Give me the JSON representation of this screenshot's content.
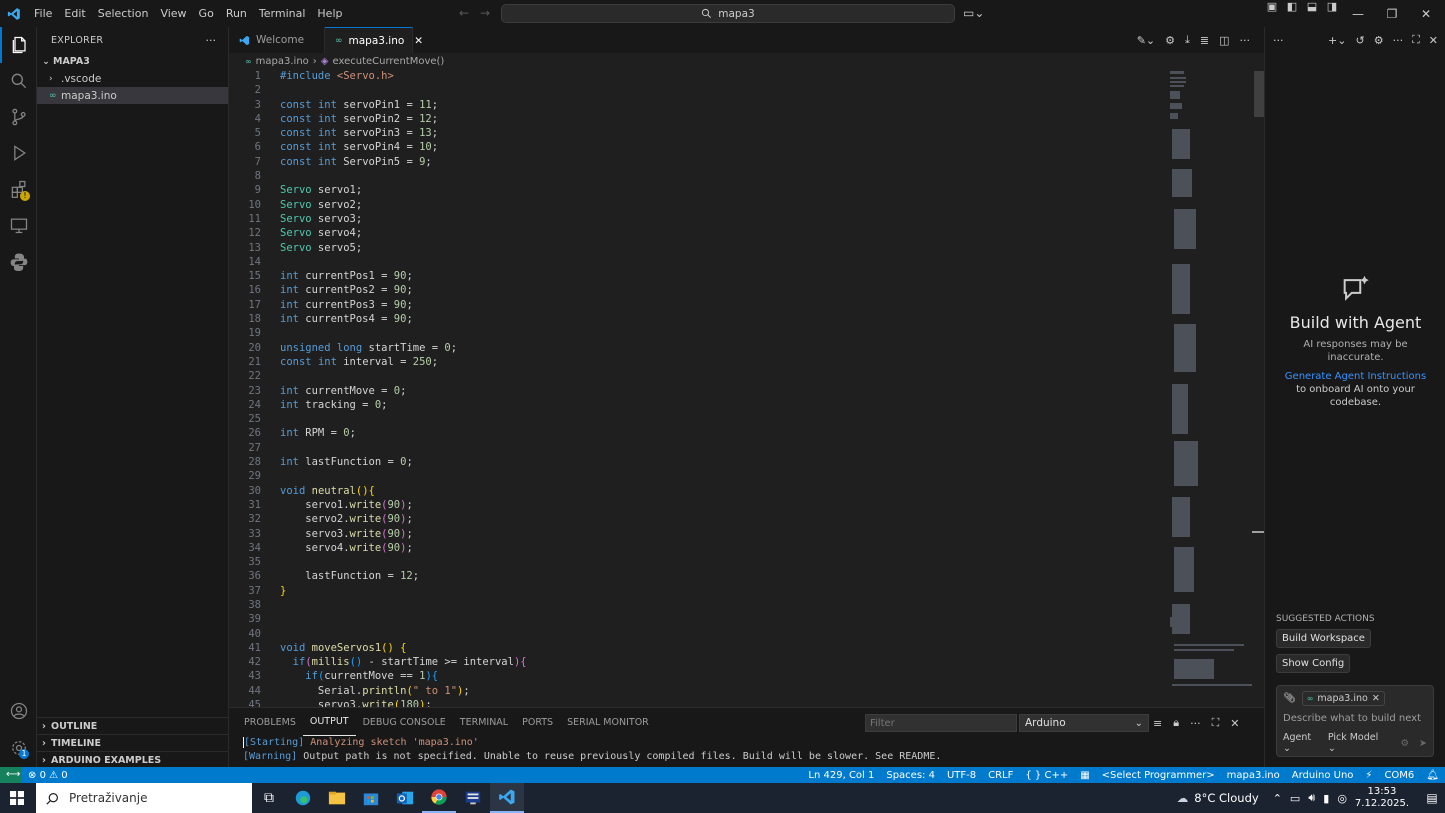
{
  "menu": [
    "File",
    "Edit",
    "Selection",
    "View",
    "Go",
    "Run",
    "Terminal",
    "Help"
  ],
  "search": {
    "text": "mapa3"
  },
  "sidebar": {
    "title": "EXPLORER",
    "root": "MAPA3",
    "items": [
      ".vscode",
      "mapa3.ino"
    ],
    "sections": [
      "OUTLINE",
      "TIMELINE",
      "ARDUINO EXAMPLES"
    ]
  },
  "tabs": [
    "Welcome",
    "mapa3.ino"
  ],
  "breadcrumb": {
    "file": "mapa3.ino",
    "symbol": "executeCurrentMove()"
  },
  "code": [
    {
      "n": "1",
      "h": "<span class='k'>#include</span> <span class='s'>&lt;Servo.h&gt;</span>"
    },
    {
      "n": "2",
      "h": ""
    },
    {
      "n": "3",
      "h": "<span class='k'>const</span> <span class='k'>int</span> servoPin1 = <span class='n'>11</span>;"
    },
    {
      "n": "4",
      "h": "<span class='k'>const</span> <span class='k'>int</span> servoPin2 = <span class='n'>12</span>;"
    },
    {
      "n": "5",
      "h": "<span class='k'>const</span> <span class='k'>int</span> servoPin3 = <span class='n'>13</span>;"
    },
    {
      "n": "6",
      "h": "<span class='k'>const</span> <span class='k'>int</span> servoPin4 = <span class='n'>10</span>;"
    },
    {
      "n": "7",
      "h": "<span class='k'>const</span> <span class='k'>int</span> ServoPin5 = <span class='n'>9</span>;"
    },
    {
      "n": "8",
      "h": ""
    },
    {
      "n": "9",
      "h": "<span class='t'>Servo</span> servo1;"
    },
    {
      "n": "10",
      "h": "<span class='t'>Servo</span> servo2;"
    },
    {
      "n": "11",
      "h": "<span class='t'>Servo</span> servo3;"
    },
    {
      "n": "12",
      "h": "<span class='t'>Servo</span> servo4;"
    },
    {
      "n": "13",
      "h": "<span class='t'>Servo</span> servo5;"
    },
    {
      "n": "14",
      "h": ""
    },
    {
      "n": "15",
      "h": "<span class='k'>int</span> currentPos1 = <span class='n'>90</span>;"
    },
    {
      "n": "16",
      "h": "<span class='k'>int</span> currentPos2 = <span class='n'>90</span>;"
    },
    {
      "n": "17",
      "h": "<span class='k'>int</span> currentPos3 = <span class='n'>90</span>;"
    },
    {
      "n": "18",
      "h": "<span class='k'>int</span> currentPos4 = <span class='n'>90</span>;"
    },
    {
      "n": "19",
      "h": ""
    },
    {
      "n": "20",
      "h": "<span class='k'>unsigned</span> <span class='k'>long</span> startTime = <span class='n'>0</span>;"
    },
    {
      "n": "21",
      "h": "<span class='k'>const</span> <span class='k'>int</span> interval = <span class='n'>250</span>;"
    },
    {
      "n": "22",
      "h": ""
    },
    {
      "n": "23",
      "h": "<span class='k'>int</span> currentMove = <span class='n'>0</span>;"
    },
    {
      "n": "24",
      "h": "<span class='k'>int</span> tracking = <span class='n'>0</span>;"
    },
    {
      "n": "25",
      "h": ""
    },
    {
      "n": "26",
      "h": "<span class='k'>int</span> RPM = <span class='n'>0</span>;"
    },
    {
      "n": "27",
      "h": ""
    },
    {
      "n": "28",
      "h": "<span class='k'>int</span> lastFunction = <span class='n'>0</span>;"
    },
    {
      "n": "29",
      "h": ""
    },
    {
      "n": "30",
      "h": "<span class='k'>void</span> <span class='f'>neutral</span><span class='b1'>()</span><span class='b1'>{</span>"
    },
    {
      "n": "31",
      "h": "    servo1.<span class='f'>write</span><span class='b2'>(</span><span class='n'>90</span><span class='b2'>)</span>;"
    },
    {
      "n": "32",
      "h": "    servo2.<span class='f'>write</span><span class='b2'>(</span><span class='n'>90</span><span class='b2'>)</span>;"
    },
    {
      "n": "33",
      "h": "    servo3.<span class='f'>write</span><span class='b2'>(</span><span class='n'>90</span><span class='b2'>)</span>;"
    },
    {
      "n": "34",
      "h": "    servo4.<span class='f'>write</span><span class='b2'>(</span><span class='n'>90</span><span class='b2'>)</span>;"
    },
    {
      "n": "35",
      "h": ""
    },
    {
      "n": "36",
      "h": "    lastFunction = <span class='n'>12</span>;"
    },
    {
      "n": "37",
      "h": "<span class='b1'>}</span>"
    },
    {
      "n": "38",
      "h": ""
    },
    {
      "n": "39",
      "h": ""
    },
    {
      "n": "40",
      "h": ""
    },
    {
      "n": "41",
      "h": "<span class='k'>void</span> <span class='f'>moveServos1</span><span class='b1'>()</span> <span class='b1'>{</span>"
    },
    {
      "n": "42",
      "h": "  <span class='k'>if</span><span class='b2'>(</span><span class='f'>millis</span><span class='b3'>()</span> - startTime &gt;= interval<span class='b2'>)</span><span class='b2'>{</span>"
    },
    {
      "n": "43",
      "h": "    <span class='k'>if</span><span class='b3'>(</span>currentMove == <span class='n'>1</span><span class='b3'>)</span><span class='b3'>{</span>"
    },
    {
      "n": "44",
      "h": "      Serial.<span class='f'>println</span><span class='b1'>(</span><span class='s'>\" to 1\"</span><span class='b1'>)</span>;"
    },
    {
      "n": "45",
      "h": "      servo3.<span class='f'>write</span><span class='b1'>(</span><span class='n'>180</span><span class='b1'>)</span>;"
    }
  ],
  "panel": {
    "tabs": [
      "PROBLEMS",
      "OUTPUT",
      "DEBUG CONSOLE",
      "TERMINAL",
      "PORTS",
      "SERIAL MONITOR"
    ],
    "filter_placeholder": "Filter",
    "channel": "Arduino",
    "lines": [
      {
        "tag": "[Starting]",
        "text": " Analyzing sketch 'mapa3.ino'"
      },
      {
        "tag": "[Warning]",
        "text": " Output path is not specified. Unable to reuse previously compiled files. Build will be slower. See README."
      }
    ]
  },
  "chat": {
    "title": "Build with Agent",
    "subtitle": "AI responses may be inaccurate.",
    "link": "Generate Agent Instructions",
    "link_suffix": " to onboard AI onto your codebase.",
    "suggested_label": "SUGGESTED ACTIONS",
    "actions": [
      "Build Workspace",
      "Show Config"
    ],
    "attachment": "mapa3.ino",
    "input_placeholder": "Describe what to build next",
    "mode": "Agent",
    "model": "Pick Model"
  },
  "status": {
    "errors": "0",
    "warnings": "0",
    "position": "Ln 429, Col 1",
    "spaces": "Spaces: 4",
    "encoding": "UTF-8",
    "eol": "CRLF",
    "language": "{ } C++",
    "programmer": "<Select Programmer>",
    "sketch": "mapa3.ino",
    "board": "Arduino Uno",
    "port": "COM6"
  },
  "taskbar": {
    "search_placeholder": "Pretraživanje",
    "weather": "8°C  Cloudy",
    "time": "13:53",
    "date": "7.12.2025."
  },
  "colors": {
    "accent": "#007acc",
    "link": "#3794ff",
    "warning_badge": "#cca700"
  }
}
